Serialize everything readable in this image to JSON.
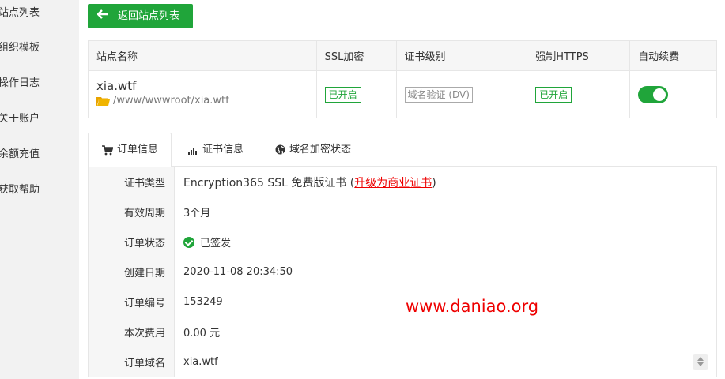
{
  "sidebar": {
    "items": [
      {
        "label": "站点列表"
      },
      {
        "label": "组织模板"
      },
      {
        "label": "操作日志"
      },
      {
        "label": "关于账户"
      },
      {
        "label": "余额充值"
      },
      {
        "label": "获取帮助"
      }
    ]
  },
  "back_button": {
    "label": "返回站点列表"
  },
  "site_table": {
    "headers": [
      "站点名称",
      "SSL加密",
      "证书级别",
      "强制HTTPS",
      "自动续费"
    ],
    "row": {
      "name": "xia.wtf",
      "path": "/www/wwwroot/xia.wtf",
      "ssl": "已开启",
      "cert_level": "域名验证 (DV)",
      "force_https": "已开启",
      "auto_renew": true
    }
  },
  "tabs": [
    {
      "label": "订单信息",
      "icon": "cart-icon"
    },
    {
      "label": "证书信息",
      "icon": "chart-icon"
    },
    {
      "label": "域名加密状态",
      "icon": "globe-icon"
    }
  ],
  "order_info": {
    "cert_type_label": "证书类型",
    "cert_type_value": "Encryption365 SSL 免费版证书",
    "upgrade_link": "升级为商业证书",
    "rows": [
      {
        "label": "有效周期",
        "value": "3个月"
      },
      {
        "label": "订单状态",
        "value": "已签发"
      },
      {
        "label": "创建日期",
        "value": "2020-11-08 20:34:50"
      },
      {
        "label": "订单编号",
        "value": "153249"
      },
      {
        "label": "本次费用",
        "value": "0.00 元"
      },
      {
        "label": "订单域名",
        "value": "xia.wtf"
      }
    ]
  },
  "watermark": "www.daniao.org",
  "colors": {
    "accent": "#20a53a",
    "link_red": "#ee0000"
  }
}
